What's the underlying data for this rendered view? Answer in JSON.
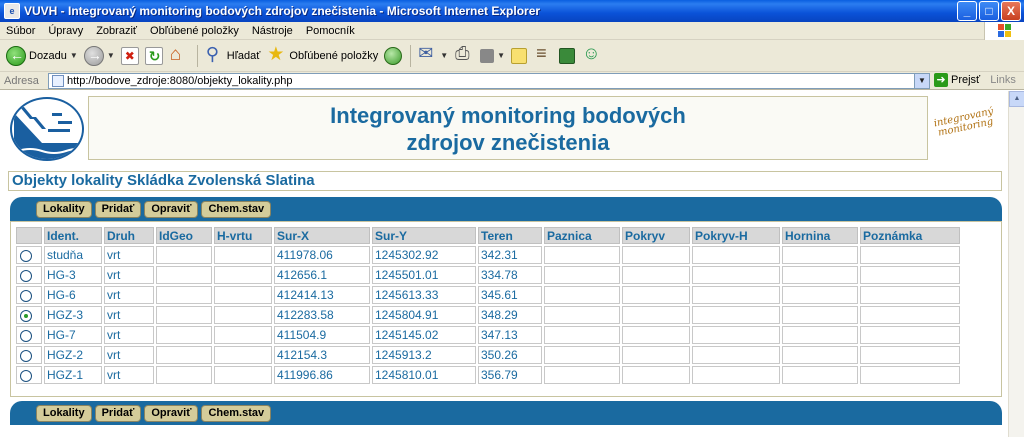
{
  "window": {
    "title": "VUVH - Integrovaný monitoring bodových zdrojov znečistenia - Microsoft Internet Explorer",
    "minimize": "_",
    "maximize": "□",
    "close": "X"
  },
  "menu": {
    "items": [
      "Súbor",
      "Úpravy",
      "Zobraziť",
      "Obľúbené položky",
      "Nástroje",
      "Pomocník"
    ]
  },
  "toolbar": {
    "back_label": "Dozadu",
    "search_label": "Hľadať",
    "favorites_label": "Obľúbené položky"
  },
  "address": {
    "label": "Adresa",
    "url": "http://bodove_zdroje:8080/objekty_lokality.php",
    "go_label": "Prejsť",
    "links_label": "Links"
  },
  "page": {
    "header_line1": "Integrovaný monitoring bodových",
    "header_line2": "zdrojov znečistenia",
    "badge_line1": "integrovaný",
    "badge_line2": "monitoring",
    "location_title": "Objekty lokality Skládka Zvolenská Slatina",
    "nav_buttons": [
      "Lokality",
      "Pridať",
      "Opraviť",
      "Chem.stav"
    ],
    "columns": [
      "Ident.",
      "Druh",
      "IdGeo",
      "H-vrtu",
      "Sur-X",
      "Sur-Y",
      "Teren",
      "Paznica",
      "Pokryv",
      "Pokryv-H",
      "Hornina",
      "Poznámka"
    ],
    "rows": [
      {
        "ident": "studňa",
        "druh": "vrt",
        "idgeo": "",
        "hvrtu": "",
        "surx": "411978.06",
        "sury": "1245302.92",
        "teren": "342.31",
        "paznica": "",
        "pokryv": "",
        "pokryvh": "",
        "hornina": "",
        "poznamka": "",
        "selected": false
      },
      {
        "ident": "HG-3",
        "druh": "vrt",
        "idgeo": "",
        "hvrtu": "",
        "surx": "412656.1",
        "sury": "1245501.01",
        "teren": "334.78",
        "paznica": "",
        "pokryv": "",
        "pokryvh": "",
        "hornina": "",
        "poznamka": "",
        "selected": false
      },
      {
        "ident": "HG-6",
        "druh": "vrt",
        "idgeo": "",
        "hvrtu": "",
        "surx": "412414.13",
        "sury": "1245613.33",
        "teren": "345.61",
        "paznica": "",
        "pokryv": "",
        "pokryvh": "",
        "hornina": "",
        "poznamka": "",
        "selected": false
      },
      {
        "ident": "HGZ-3",
        "druh": "vrt",
        "idgeo": "",
        "hvrtu": "",
        "surx": "412283.58",
        "sury": "1245804.91",
        "teren": "348.29",
        "paznica": "",
        "pokryv": "",
        "pokryvh": "",
        "hornina": "",
        "poznamka": "",
        "selected": true
      },
      {
        "ident": "HG-7",
        "druh": "vrt",
        "idgeo": "",
        "hvrtu": "",
        "surx": "411504.9",
        "sury": "1245145.02",
        "teren": "347.13",
        "paznica": "",
        "pokryv": "",
        "pokryvh": "",
        "hornina": "",
        "poznamka": "",
        "selected": false
      },
      {
        "ident": "HGZ-2",
        "druh": "vrt",
        "idgeo": "",
        "hvrtu": "",
        "surx": "412154.3",
        "sury": "1245913.2",
        "teren": "350.26",
        "paznica": "",
        "pokryv": "",
        "pokryvh": "",
        "hornina": "",
        "poznamka": "",
        "selected": false
      },
      {
        "ident": "HGZ-1",
        "druh": "vrt",
        "idgeo": "",
        "hvrtu": "",
        "surx": "411996.86",
        "sury": "1245810.01",
        "teren": "356.79",
        "paznica": "",
        "pokryv": "",
        "pokryvh": "",
        "hornina": "",
        "poznamka": "",
        "selected": false
      }
    ]
  },
  "colors": {
    "accent": "#1a6aa0",
    "button_bg": "#d4cc9a",
    "titlebar": "#0a52d8"
  }
}
